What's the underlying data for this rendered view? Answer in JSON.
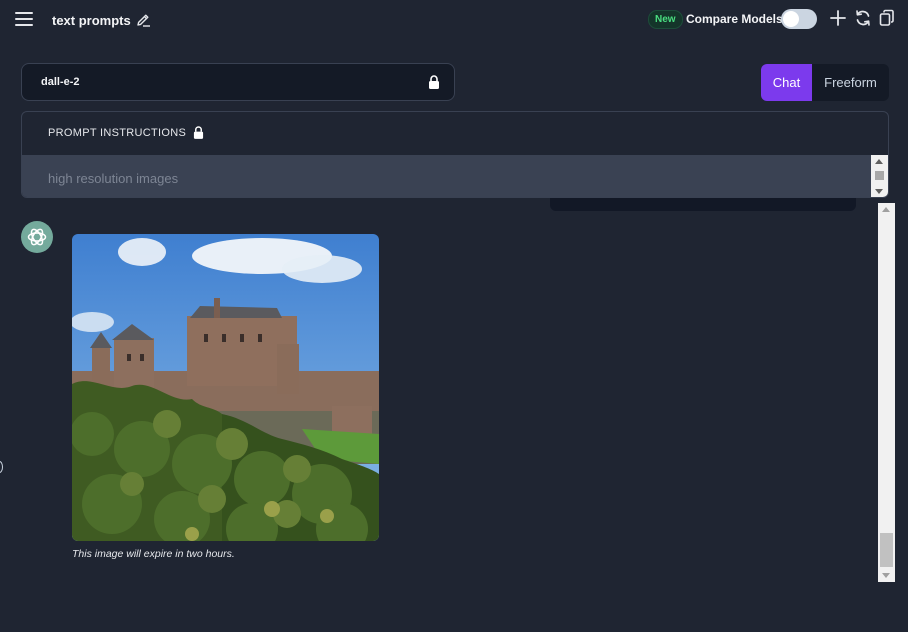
{
  "header": {
    "title": "text prompts",
    "new_badge": "New",
    "compare_label": "Compare Models",
    "compare_enabled": false
  },
  "model": {
    "name": "dall-e-2",
    "locked": true
  },
  "modes": {
    "chat": "Chat",
    "freeform": "Freeform",
    "active": "Chat"
  },
  "instructions": {
    "title": "PROMPT INSTRUCTIONS",
    "text": "high resolution images"
  },
  "message": {
    "caption": "This image will expire in two hours."
  },
  "colors": {
    "accent": "#7c3aed",
    "background": "#1f2532",
    "badge_green": "#4ade80",
    "avatar": "#74aa9c"
  },
  "icons": [
    "menu-icon",
    "edit-icon",
    "plus-icon",
    "refresh-icon",
    "copy-icon",
    "lock-icon",
    "openai-icon"
  ]
}
